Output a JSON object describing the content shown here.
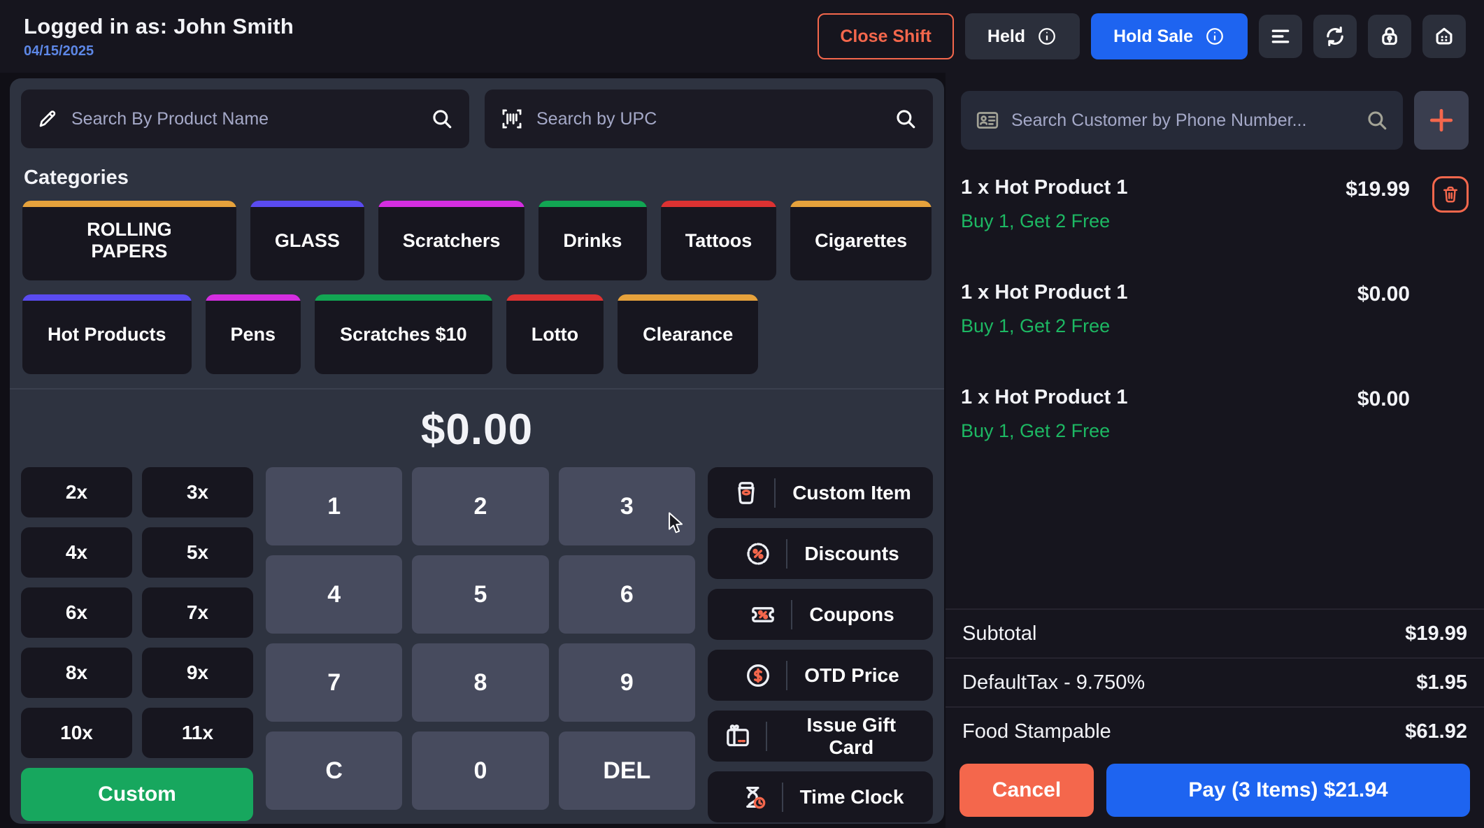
{
  "header": {
    "logged_in": "Logged in as: John Smith",
    "date": "04/15/2025",
    "close_shift_label": "Close Shift",
    "held_label": "Held",
    "hold_sale_label": "Hold Sale"
  },
  "search": {
    "product_placeholder": "Search By Product Name",
    "upc_placeholder": "Search by UPC",
    "customer_placeholder": "Search Customer by Phone Number..."
  },
  "categories": {
    "title": "Categories",
    "row1": [
      {
        "label": "ROLLING PAPERS",
        "accent": "#e6a23c"
      },
      {
        "label": "GLASS",
        "accent": "#5a4bf0"
      },
      {
        "label": "Scratchers",
        "accent": "#d42ee0"
      },
      {
        "label": "Drinks",
        "accent": "#12a653"
      },
      {
        "label": "Tattoos",
        "accent": "#dc3232"
      },
      {
        "label": "Cigarettes",
        "accent": "#e6a23c"
      }
    ],
    "row2": [
      {
        "label": "Hot Products",
        "accent": "#5a4bf0"
      },
      {
        "label": "Pens",
        "accent": "#d42ee0"
      },
      {
        "label": "Scratches $10",
        "accent": "#12a653"
      },
      {
        "label": "Lotto",
        "accent": "#dc3232"
      },
      {
        "label": "Clearance",
        "accent": "#e6a23c"
      }
    ]
  },
  "amount_display": "$0.00",
  "keypad": {
    "multipliers": [
      "2x",
      "3x",
      "4x",
      "5x",
      "6x",
      "7x",
      "8x",
      "9x",
      "10x",
      "11x"
    ],
    "custom_label": "Custom",
    "digits": [
      "1",
      "2",
      "3",
      "4",
      "5",
      "6",
      "7",
      "8",
      "9",
      "C",
      "0",
      "DEL"
    ]
  },
  "actions": [
    {
      "label": "Custom Item",
      "icon": "box-icon"
    },
    {
      "label": "Discounts",
      "icon": "discount-badge-icon"
    },
    {
      "label": "Coupons",
      "icon": "coupon-ticket-icon"
    },
    {
      "label": "OTD Price",
      "icon": "dollar-circle-icon"
    },
    {
      "label": "Issue Gift Card",
      "icon": "gift-card-icon"
    },
    {
      "label": "Time Clock",
      "icon": "hourglass-clock-icon"
    }
  ],
  "cart": {
    "items": [
      {
        "name": "1 x Hot Product 1",
        "price": "$19.99",
        "promo": "Buy 1, Get 2 Free"
      },
      {
        "name": "1 x Hot Product 1",
        "price": "$0.00",
        "promo": "Buy 1, Get 2 Free"
      },
      {
        "name": "1 x Hot Product 1",
        "price": "$0.00",
        "promo": "Buy 1, Get 2 Free"
      }
    ]
  },
  "totals": {
    "rows": [
      {
        "label": "Subtotal",
        "value": "$19.99"
      },
      {
        "label": "DefaultTax - 9.750%",
        "value": "$1.95"
      },
      {
        "label": "Food Stampable",
        "value": "$61.92"
      }
    ],
    "cancel_label": "Cancel",
    "pay_label": "Pay (3 Items) $21.94"
  },
  "colors": {
    "coral_accent": "#f4674c",
    "primary_blue": "#1e64f0",
    "green_button": "#17a75e",
    "promo_green": "#1db863",
    "date_blue": "#5d87e6"
  }
}
